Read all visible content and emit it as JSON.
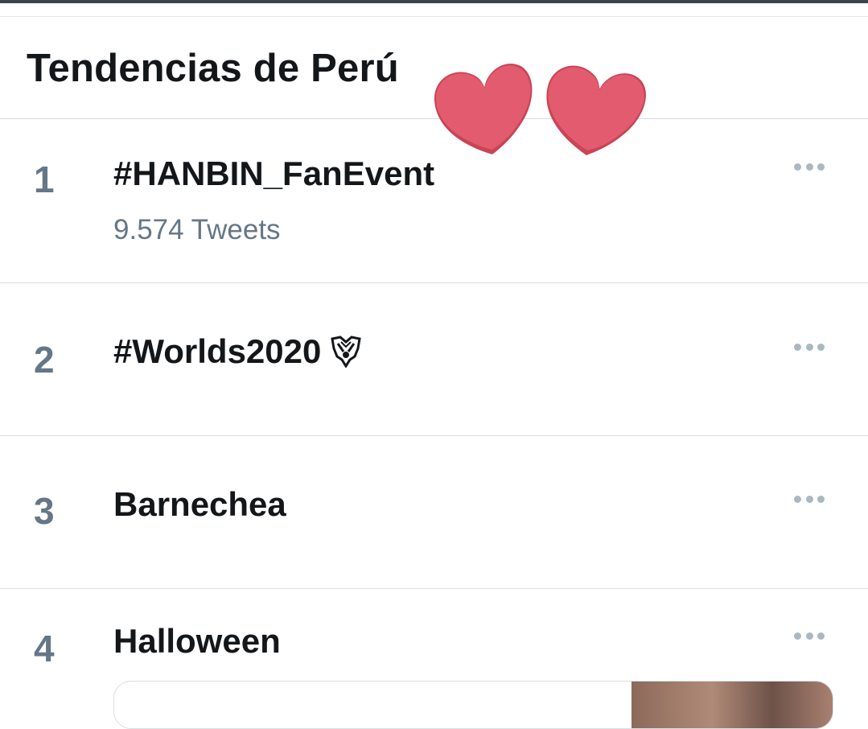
{
  "header": {
    "title": "Tendencias de Perú"
  },
  "trends": [
    {
      "rank": "1",
      "name": "#HANBIN_FanEvent",
      "count": "9.574 Tweets"
    },
    {
      "rank": "2",
      "name": "#Worlds2020",
      "count": ""
    },
    {
      "rank": "3",
      "name": "Barnechea",
      "count": ""
    },
    {
      "rank": "4",
      "name": "Halloween",
      "count": ""
    }
  ],
  "colors": {
    "heart": "#e25b6e",
    "text_primary": "#14171a",
    "text_secondary": "#657786"
  },
  "icons": {
    "more": "more-dots-icon",
    "worlds": "worlds-emblem-icon",
    "sticker": "hearts-sticker"
  }
}
